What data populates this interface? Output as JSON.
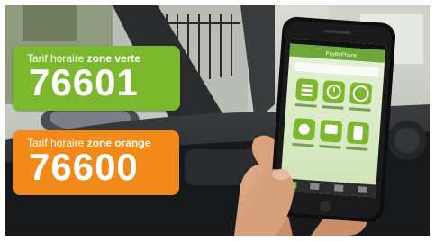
{
  "colors": {
    "green_zone": "#7cb82e",
    "orange_zone": "#f28a1a"
  },
  "cards": [
    {
      "caption_prefix": "Tarif horaire ",
      "caption_zone": "zone verte",
      "number": "76601",
      "color": "#7cb82e"
    },
    {
      "caption_prefix": "Tarif horaire ",
      "caption_zone": "zone orange",
      "number": "76600",
      "color": "#f28a1a"
    }
  ],
  "phone": {
    "app_name": "PayByPhone",
    "icons": [
      {
        "label": "plan de stationn.",
        "icon": "list-icon"
      },
      {
        "label": "prolonger à distance",
        "icon": "clock-icon"
      },
      {
        "label": "payer le parking",
        "icon": "stop-icon"
      },
      {
        "label": "prix de parking",
        "icon": "coins-icon"
      },
      {
        "label": "alerte SMS avant la fin",
        "icon": "sms-icon"
      },
      {
        "label": "payer avec téléphone",
        "icon": "phone-icon"
      }
    ]
  }
}
